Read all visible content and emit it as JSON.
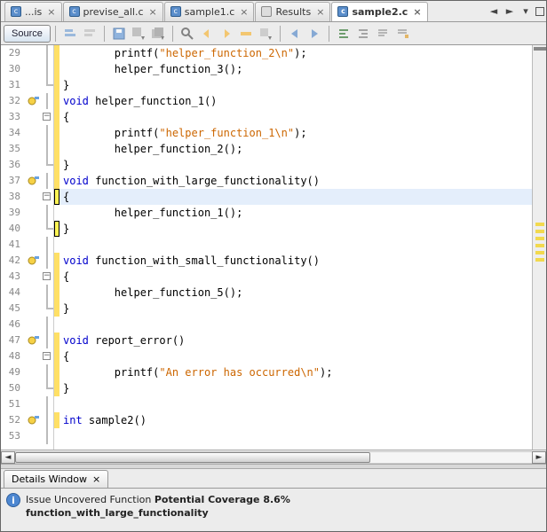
{
  "tabs": [
    {
      "label": "...is",
      "kind": "file",
      "closable": true
    },
    {
      "label": "previse_all.c",
      "kind": "c",
      "closable": true
    },
    {
      "label": "sample1.c",
      "kind": "c",
      "closable": true
    },
    {
      "label": "Results",
      "kind": "res",
      "closable": true
    },
    {
      "label": "sample2.c",
      "kind": "c",
      "closable": true,
      "active": true
    }
  ],
  "source": {
    "label": "Source"
  },
  "code": {
    "firstLine": 29,
    "lines": [
      {
        "n": 29,
        "cov": "y",
        "txt": "        printf(§\"helper_function_2\\n\"§);"
      },
      {
        "n": 30,
        "cov": "y",
        "txt": "        helper_function_3();"
      },
      {
        "n": 31,
        "cov": "y",
        "txt": "}",
        "endfold": true
      },
      {
        "n": 32,
        "cov": "y",
        "fold": true,
        "mark": true,
        "txt": "¤void¤ helper_function_1()"
      },
      {
        "n": 33,
        "cov": "y",
        "foldbox": true,
        "txt": "{"
      },
      {
        "n": 34,
        "cov": "y",
        "txt": "        printf(§\"helper_function_1\\n\"§);"
      },
      {
        "n": 35,
        "cov": "y",
        "txt": "        helper_function_2();"
      },
      {
        "n": 36,
        "cov": "y",
        "txt": "}",
        "endfold": true
      },
      {
        "n": 37,
        "cov": "y",
        "fold": true,
        "mark": true,
        "txt": "¤void¤ function_with_large_functionality()"
      },
      {
        "n": 38,
        "cov": "hl",
        "foldbox": true,
        "hl": true,
        "txt": "{"
      },
      {
        "n": 39,
        "txt": "        helper_function_1();"
      },
      {
        "n": 40,
        "cov": "hl",
        "txt": "}",
        "endfold": true
      },
      {
        "n": 41,
        "txt": ""
      },
      {
        "n": 42,
        "cov": "y",
        "fold": true,
        "mark": true,
        "txt": "¤void¤ function_with_small_functionality()"
      },
      {
        "n": 43,
        "cov": "y",
        "foldbox": true,
        "txt": "{"
      },
      {
        "n": 44,
        "cov": "y",
        "txt": "        helper_function_5();"
      },
      {
        "n": 45,
        "cov": "y",
        "txt": "}",
        "endfold": true
      },
      {
        "n": 46,
        "txt": ""
      },
      {
        "n": 47,
        "cov": "y",
        "fold": true,
        "mark": true,
        "txt": "¤void¤ report_error()"
      },
      {
        "n": 48,
        "cov": "y",
        "foldbox": true,
        "txt": "{"
      },
      {
        "n": 49,
        "cov": "y",
        "txt": "        printf(§\"An error has occurred\\n\"§);"
      },
      {
        "n": 50,
        "cov": "y",
        "txt": "}",
        "endfold": true
      },
      {
        "n": 51,
        "txt": ""
      },
      {
        "n": 52,
        "cov": "y",
        "fold": true,
        "mark": true,
        "txt": "¤int¤ sample2()"
      },
      {
        "n": 53,
        "txt": ""
      }
    ]
  },
  "details": {
    "tab_label": "Details Window",
    "line1_a": "Issue Uncovered Function ",
    "line1_b": "Potential Coverage 8.6%",
    "line2": "function_with_large_functionality"
  }
}
